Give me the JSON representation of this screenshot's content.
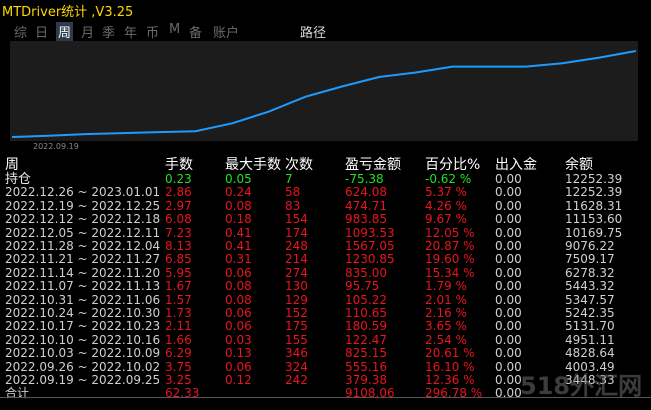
{
  "app": {
    "title": "MTDriver统计 ,V3.25"
  },
  "tabs": [
    {
      "label": "综"
    },
    {
      "label": "日"
    },
    {
      "label": "周"
    },
    {
      "label": "月"
    },
    {
      "label": "季"
    },
    {
      "label": "年"
    },
    {
      "label": "币"
    },
    {
      "label": "M"
    },
    {
      "label": "备"
    },
    {
      "label": "账户"
    },
    {
      "label": "路径"
    }
  ],
  "chart_data": {
    "type": "line",
    "x_tick_labels": [
      "2022.09.19"
    ],
    "series": [
      {
        "values": [
          4828.64,
          4951.11,
          5131.7,
          5242.35,
          5347.57,
          5443.32,
          6278.32,
          7509.17,
          9076.22,
          10169.75,
          11153.6,
          11628.31,
          12252.39,
          12252.39,
          12252.39,
          12600.0,
          13200.0,
          13900.0
        ]
      }
    ],
    "line_color": "#1e9bff"
  },
  "headers": {
    "period": "周",
    "lots": "手数",
    "max_lots": "最大手数",
    "count": "次数",
    "pl": "盈亏金额",
    "pct": "百分比%",
    "deposit": "出入金",
    "balance": "余额"
  },
  "holding": {
    "period": "持仓",
    "lots": "0.23",
    "max_lots": "0.05",
    "count": "7",
    "pl": "-75.38",
    "pct": "-0.62 %",
    "deposit": "0.00",
    "balance": "12252.39"
  },
  "rows": [
    {
      "period": "2022.12.26 ~ 2023.01.01",
      "lots": "2.86",
      "max_lots": "0.24",
      "count": "58",
      "pl": "624.08",
      "pct": "5.37 %",
      "deposit": "0.00",
      "balance": "12252.39"
    },
    {
      "period": "2022.12.19 ~ 2022.12.25",
      "lots": "2.97",
      "max_lots": "0.08",
      "count": "83",
      "pl": "474.71",
      "pct": "4.26 %",
      "deposit": "0.00",
      "balance": "11628.31"
    },
    {
      "period": "2022.12.12 ~ 2022.12.18",
      "lots": "6.08",
      "max_lots": "0.18",
      "count": "154",
      "pl": "983.85",
      "pct": "9.67 %",
      "deposit": "0.00",
      "balance": "11153.60"
    },
    {
      "period": "2022.12.05 ~ 2022.12.11",
      "lots": "7.23",
      "max_lots": "0.41",
      "count": "174",
      "pl": "1093.53",
      "pct": "12.05 %",
      "deposit": "0.00",
      "balance": "10169.75"
    },
    {
      "period": "2022.11.28 ~ 2022.12.04",
      "lots": "8.13",
      "max_lots": "0.41",
      "count": "248",
      "pl": "1567.05",
      "pct": "20.87 %",
      "deposit": "0.00",
      "balance": "9076.22"
    },
    {
      "period": "2022.11.21 ~ 2022.11.27",
      "lots": "6.85",
      "max_lots": "0.31",
      "count": "214",
      "pl": "1230.85",
      "pct": "19.60 %",
      "deposit": "0.00",
      "balance": "7509.17"
    },
    {
      "period": "2022.11.14 ~ 2022.11.20",
      "lots": "5.95",
      "max_lots": "0.06",
      "count": "274",
      "pl": "835.00",
      "pct": "15.34 %",
      "deposit": "0.00",
      "balance": "6278.32"
    },
    {
      "period": "2022.11.07 ~ 2022.11.13",
      "lots": "1.67",
      "max_lots": "0.08",
      "count": "130",
      "pl": "95.75",
      "pct": "1.79 %",
      "deposit": "0.00",
      "balance": "5443.32"
    },
    {
      "period": "2022.10.31 ~ 2022.11.06",
      "lots": "1.57",
      "max_lots": "0.08",
      "count": "129",
      "pl": "105.22",
      "pct": "2.01 %",
      "deposit": "0.00",
      "balance": "5347.57"
    },
    {
      "period": "2022.10.24 ~ 2022.10.30",
      "lots": "1.73",
      "max_lots": "0.06",
      "count": "152",
      "pl": "110.65",
      "pct": "2.16 %",
      "deposit": "0.00",
      "balance": "5242.35"
    },
    {
      "period": "2022.10.17 ~ 2022.10.23",
      "lots": "2.11",
      "max_lots": "0.06",
      "count": "175",
      "pl": "180.59",
      "pct": "3.65 %",
      "deposit": "0.00",
      "balance": "5131.70"
    },
    {
      "period": "2022.10.10 ~ 2022.10.16",
      "lots": "1.66",
      "max_lots": "0.03",
      "count": "155",
      "pl": "122.47",
      "pct": "2.54 %",
      "deposit": "0.00",
      "balance": "4951.11"
    },
    {
      "period": "2022.10.03 ~ 2022.10.09",
      "lots": "6.29",
      "max_lots": "0.13",
      "count": "346",
      "pl": "825.15",
      "pct": "20.61 %",
      "deposit": "0.00",
      "balance": "4828.64"
    },
    {
      "period": "2022.09.26 ~ 2022.10.02",
      "lots": "3.75",
      "max_lots": "0.06",
      "count": "324",
      "pl": "555.16",
      "pct": "16.10 %",
      "deposit": "0.00",
      "balance": "4003.49"
    },
    {
      "period": "2022.09.19 ~ 2022.09.25",
      "lots": "3.25",
      "max_lots": "0.12",
      "count": "242",
      "pl": "379.38",
      "pct": "12.36 %",
      "deposit": "0.00",
      "balance": "3448.33"
    }
  ],
  "total": {
    "period": "合计",
    "lots": "62.33",
    "max_lots": "",
    "count": "",
    "pl": "9108.06",
    "pct": "296.78 %",
    "deposit": "0.00",
    "balance": ""
  },
  "watermark": "518外汇网",
  "colors": {
    "title": "#ffd700",
    "loss": "#22e022",
    "profit": "#e8141e",
    "line": "#1e9bff"
  }
}
